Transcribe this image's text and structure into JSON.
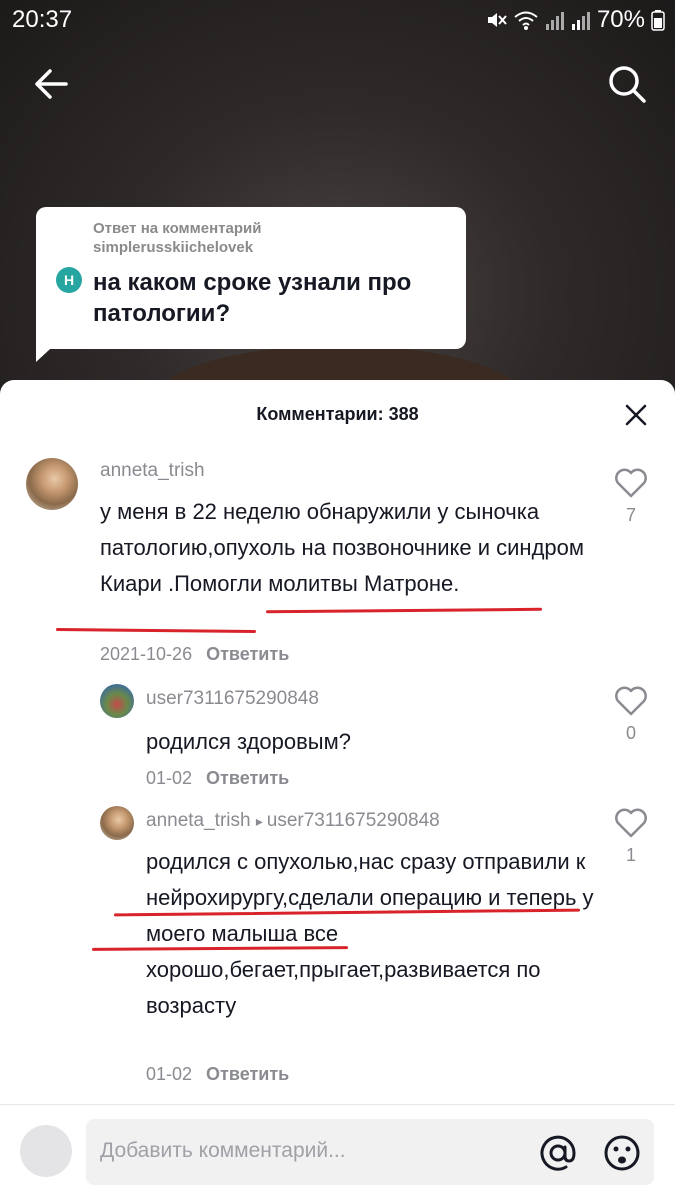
{
  "status_bar": {
    "time": "20:37",
    "battery": "70%"
  },
  "reply_bubble": {
    "header_line1": "Ответ на комментарий",
    "header_line2": "simplerusskiichelovek",
    "avatar_letter": "H",
    "question": "на каком сроке узнали про патологии?"
  },
  "comments_sheet": {
    "title": "Комментарии: 388",
    "comments": [
      {
        "username": "anneta_trish",
        "text": "у меня в 22 неделю обнаружили у сыночка патологию,опухоль на позвоночнике и синдром Киари .Помогли молитвы Матроне.",
        "date": "2021-10-26",
        "reply_label": "Ответить",
        "likes": "7"
      },
      {
        "username": "user7311675290848",
        "text": "родился здоровым?",
        "date": "01-02",
        "reply_label": "Ответить",
        "likes": "0"
      },
      {
        "username": "anneta_trish",
        "reply_to": "user7311675290848",
        "text": "родился с опухолью,нас сразу отправили к нейрохирургу,сделали операцию и теперь у моего малыша все хорошо,бегает,прыгает,развивается по возрасту",
        "date": "01-02",
        "reply_label": "Ответить",
        "likes": "1"
      }
    ]
  },
  "input": {
    "placeholder": "Добавить комментарий..."
  },
  "colors": {
    "underline": "#d8232a",
    "avatar_letter_bg": "#27a6a1"
  }
}
